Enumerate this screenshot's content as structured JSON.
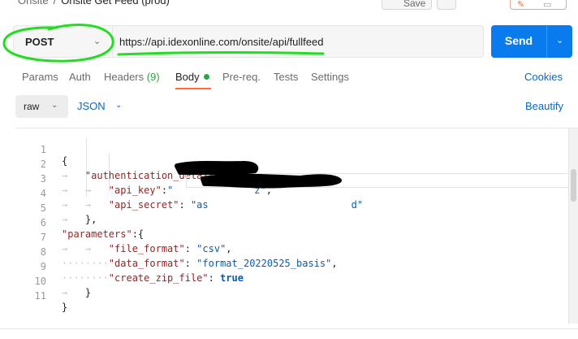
{
  "breadcrumb": {
    "collection": "Onsite",
    "separator": "/",
    "request": "Onsite Get Feed (prod)"
  },
  "toolbar": {
    "save_label": "Save"
  },
  "request": {
    "method": "POST",
    "url": "https://api.idexonline.com/onsite/api/fullfeed",
    "send_label": "Send"
  },
  "tabs": {
    "params": "Params",
    "auth": "Auth",
    "headers": "Headers",
    "headers_count": "(9)",
    "body": "Body",
    "prereq": "Pre-req.",
    "tests": "Tests",
    "settings": "Settings",
    "cookies": "Cookies"
  },
  "body_options": {
    "mode": "raw",
    "language": "JSON",
    "beautify": "Beautify"
  },
  "editor": {
    "line_numbers": [
      "1",
      "2",
      "3",
      "4",
      "5",
      "6",
      "7",
      "8",
      "9",
      "10",
      "11"
    ],
    "lines": [
      "{",
      "\"authentication_details\":{",
      "\"api_key\":\"",
      "\"api_secret\": \"as",
      "},",
      "\"parameters\":{",
      "\"file_format\": \"csv\",",
      "\"data_format\": \"format_20220525_basis\",",
      "\"create_zip_file\": true",
      "}",
      "}"
    ],
    "l1": "{",
    "l2_key": "\"authentication_details\"",
    "l2_rest": ":{",
    "l3_key": "\"api_key\"",
    "l3_colon": ":",
    "l3_val": "\"",
    "l3_end_val": "z\"",
    "l3_comma": ",",
    "l4_key": "\"api_secret\"",
    "l4_colon": ": ",
    "l4_val": "\"as",
    "l4_end_val": "d\"",
    "l5": "},",
    "l6_key": "\"parameters\"",
    "l6_rest": ":{",
    "l7_key": "\"file_format\"",
    "l7_colon": ": ",
    "l7_val": "\"csv\"",
    "l7_comma": ",",
    "l8_key": "\"data_format\"",
    "l8_colon": ": ",
    "l8_val": "\"format_20220525_basis\"",
    "l8_comma": ",",
    "l9_key": "\"create_zip_file\"",
    "l9_colon": ": ",
    "l9_val": "true",
    "l10": "}",
    "l11": "}"
  },
  "colors": {
    "send": "#097bed",
    "link": "#0b66c3",
    "active_tab_underline": "#ff6c37",
    "annotation": "#22dd22",
    "json_key": "#9b2222",
    "json_string": "#0b5cad"
  }
}
